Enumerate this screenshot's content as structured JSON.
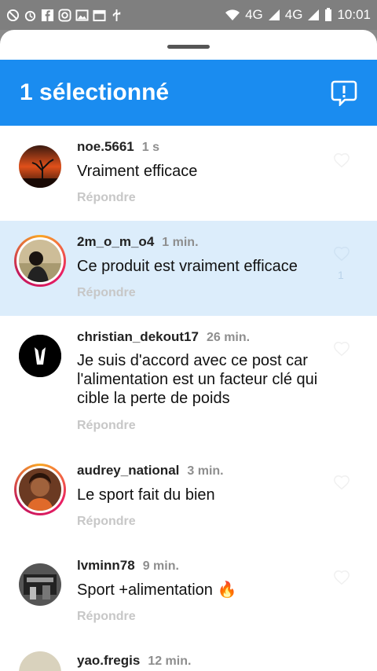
{
  "status_bar": {
    "time": "10:01",
    "network1": "4G",
    "network2": "4G",
    "icons_left": [
      "no-disturb-icon",
      "alarm-icon",
      "facebook-icon",
      "instagram-icon",
      "gallery-icon",
      "calendar-icon",
      "usb-icon"
    ]
  },
  "header": {
    "title": "1 sélectionné",
    "color": "#1a8cf0"
  },
  "comments": [
    {
      "user": "noe.5661",
      "time": "1 s",
      "text": "Vraiment efficace",
      "reply": "Répondre",
      "likes": ""
    },
    {
      "user": "2m_o_m_o4",
      "time": "1 min.",
      "text": "Ce produit est vraiment efficace",
      "reply": "Répondre",
      "likes": "1"
    },
    {
      "user": "christian_dekout17",
      "time": "26 min.",
      "text": "Je suis d'accord avec ce post car l'alimentation est un facteur clé qui cible la perte de poids",
      "reply": "Répondre",
      "likes": ""
    },
    {
      "user": "audrey_national",
      "time": "3 min.",
      "text": "Le sport fait du bien",
      "reply": "Répondre",
      "likes": ""
    },
    {
      "user": "lvminn78",
      "time": "9 min.",
      "text": "Sport +alimentation 🔥",
      "reply": "Répondre",
      "likes": ""
    },
    {
      "user": "yao.fregis",
      "time": "12 min.",
      "text": "",
      "reply": "",
      "likes": ""
    }
  ]
}
